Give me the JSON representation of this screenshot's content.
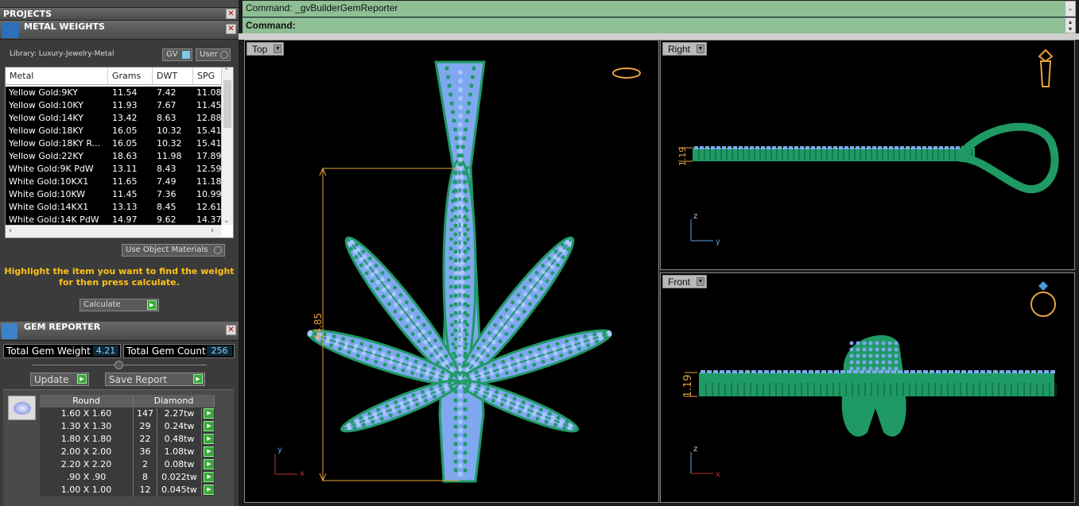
{
  "projects": {
    "title": "PROJECTS"
  },
  "metal_weights": {
    "title": "METAL WEIGHTS",
    "library": "Library: Luxury-Jewelry-Metal",
    "gv_label": "GV",
    "user_label": "User",
    "columns": [
      "Metal",
      "Grams",
      "DWT",
      "SPG"
    ],
    "rows": [
      {
        "metal": "Yellow Gold:9KY",
        "grams": "11.54",
        "dwt": "7.42",
        "spg": "11.08"
      },
      {
        "metal": "Yellow Gold:10KY",
        "grams": "11.93",
        "dwt": "7.67",
        "spg": "11.45"
      },
      {
        "metal": "Yellow Gold:14KY",
        "grams": "13.42",
        "dwt": "8.63",
        "spg": "12.88"
      },
      {
        "metal": "Yellow Gold:18KY",
        "grams": "16.05",
        "dwt": "10.32",
        "spg": "15.41"
      },
      {
        "metal": "Yellow Gold:18KY R...",
        "grams": "16.05",
        "dwt": "10.32",
        "spg": "15.41"
      },
      {
        "metal": "Yellow Gold:22KY",
        "grams": "18.63",
        "dwt": "11.98",
        "spg": "17.89"
      },
      {
        "metal": "White Gold:9K PdW",
        "grams": "13.11",
        "dwt": "8.43",
        "spg": "12.59"
      },
      {
        "metal": "White Gold:10KX1",
        "grams": "11.65",
        "dwt": "7.49",
        "spg": "11.18"
      },
      {
        "metal": "White Gold:10KW",
        "grams": "11.45",
        "dwt": "7.36",
        "spg": "10.99"
      },
      {
        "metal": "White Gold:14KX1",
        "grams": "13.13",
        "dwt": "8.45",
        "spg": "12.61"
      },
      {
        "metal": "White Gold:14K PdW",
        "grams": "14.97",
        "dwt": "9.62",
        "spg": "14.37"
      }
    ],
    "use_object_materials": "Use Object Materials",
    "hint_line1": "Highlight the item you want to find the weight",
    "hint_line2": "for then press calculate.",
    "calculate": "Calculate"
  },
  "gem_reporter": {
    "title": "GEM REPORTER",
    "total_weight_label": "Total Gem Weight",
    "total_weight": "4.21",
    "total_count_label": "Total Gem Count",
    "total_count": "256",
    "update": "Update",
    "save_report": "Save Report",
    "header_shape": "Round",
    "header_type": "Diamond",
    "rows": [
      {
        "size": "1.60 X 1.60",
        "count": "147",
        "tw": "2.27tw"
      },
      {
        "size": "1.30 X 1.30",
        "count": "29",
        "tw": "0.24tw"
      },
      {
        "size": "1.80 X 1.80",
        "count": "22",
        "tw": "0.48tw"
      },
      {
        "size": "2.00 X 2.00",
        "count": "36",
        "tw": "1.08tw"
      },
      {
        "size": "2.20 X 2.20",
        "count": "2",
        "tw": "0.08tw"
      },
      {
        "size": ".90 X .90",
        "count": "8",
        "tw": "0.022tw"
      },
      {
        "size": "1.00 X 1.00",
        "count": "12",
        "tw": "0.045tw"
      }
    ]
  },
  "command": {
    "line1": "Command: _gvBuilderGemReporter",
    "line2": "Command:"
  },
  "viewports": {
    "top": "Top",
    "right": "Right",
    "front": "Front",
    "dim_top": "44.85",
    "dim_side": "1.19",
    "axis_x": "x",
    "axis_y": "y",
    "axis_z": "z"
  },
  "colors": {
    "gem": "#7fa8f0",
    "metal": "#1f9a64",
    "dim": "#e8a040"
  }
}
